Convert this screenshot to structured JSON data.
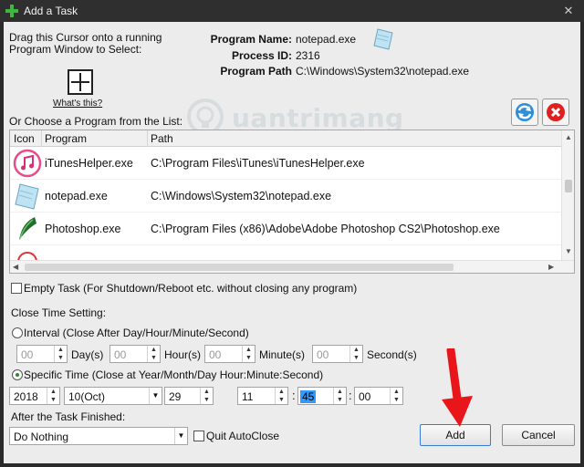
{
  "window": {
    "title": "Add a Task",
    "close_glyph": "✕"
  },
  "target": {
    "instruction_line1": "Drag this Cursor onto a running",
    "instruction_line2": "Program Window to Select:",
    "whats_this": "What's this?"
  },
  "program_info": {
    "name_label": "Program Name:",
    "name_value": "notepad.exe",
    "pid_label": "Process ID:",
    "pid_value": "2316",
    "path_label": "Program Path",
    "path_value": "C:\\Windows\\System32\\notepad.exe"
  },
  "watermark": {
    "text": "uantrimang"
  },
  "list_section": {
    "label": "Or Choose a Program from the List:",
    "columns": [
      "Icon",
      "Program",
      "Path"
    ],
    "rows": [
      {
        "icon": "itunes-icon",
        "program": "iTunesHelper.exe",
        "path": "C:\\Program Files\\iTunes\\iTunesHelper.exe"
      },
      {
        "icon": "notepad-icon",
        "program": "notepad.exe",
        "path": "C:\\Windows\\System32\\notepad.exe"
      },
      {
        "icon": "photoshop-icon",
        "program": "Photoshop.exe",
        "path": "C:\\Program Files (x86)\\Adobe\\Adobe Photoshop CS2\\Photoshop.exe"
      },
      {
        "icon": "app-icon",
        "program": "",
        "path": ""
      }
    ]
  },
  "empty_task": {
    "label": "Empty Task (For Shutdown/Reboot etc. without closing any program)",
    "checked": false
  },
  "close_time": {
    "heading": "Close Time Setting:",
    "interval_label": "Interval (Close After Day/Hour/Minute/Second)",
    "interval_selected": false,
    "interval_fields": [
      {
        "value": "00",
        "unit": "Day(s)"
      },
      {
        "value": "00",
        "unit": "Hour(s)"
      },
      {
        "value": "00",
        "unit": "Minute(s)"
      },
      {
        "value": "00",
        "unit": "Second(s)"
      }
    ],
    "specific_label": "Specific Time (Close at Year/Month/Day Hour:Minute:Second)",
    "specific_selected": true,
    "year": "2018",
    "month": "10(Oct)",
    "day": "29",
    "hour": "11",
    "minute": "45",
    "second": "00",
    "colon": ":"
  },
  "after_task": {
    "label": "After the Task Finished:",
    "action": "Do Nothing",
    "quit_autoclose_label": "Quit AutoClose",
    "quit_autoclose_checked": false
  },
  "buttons": {
    "add": "Add",
    "cancel": "Cancel"
  },
  "colors": {
    "accent": "#3399ff",
    "arrow": "#e8161b",
    "title_bar": "#2f2f2f"
  }
}
